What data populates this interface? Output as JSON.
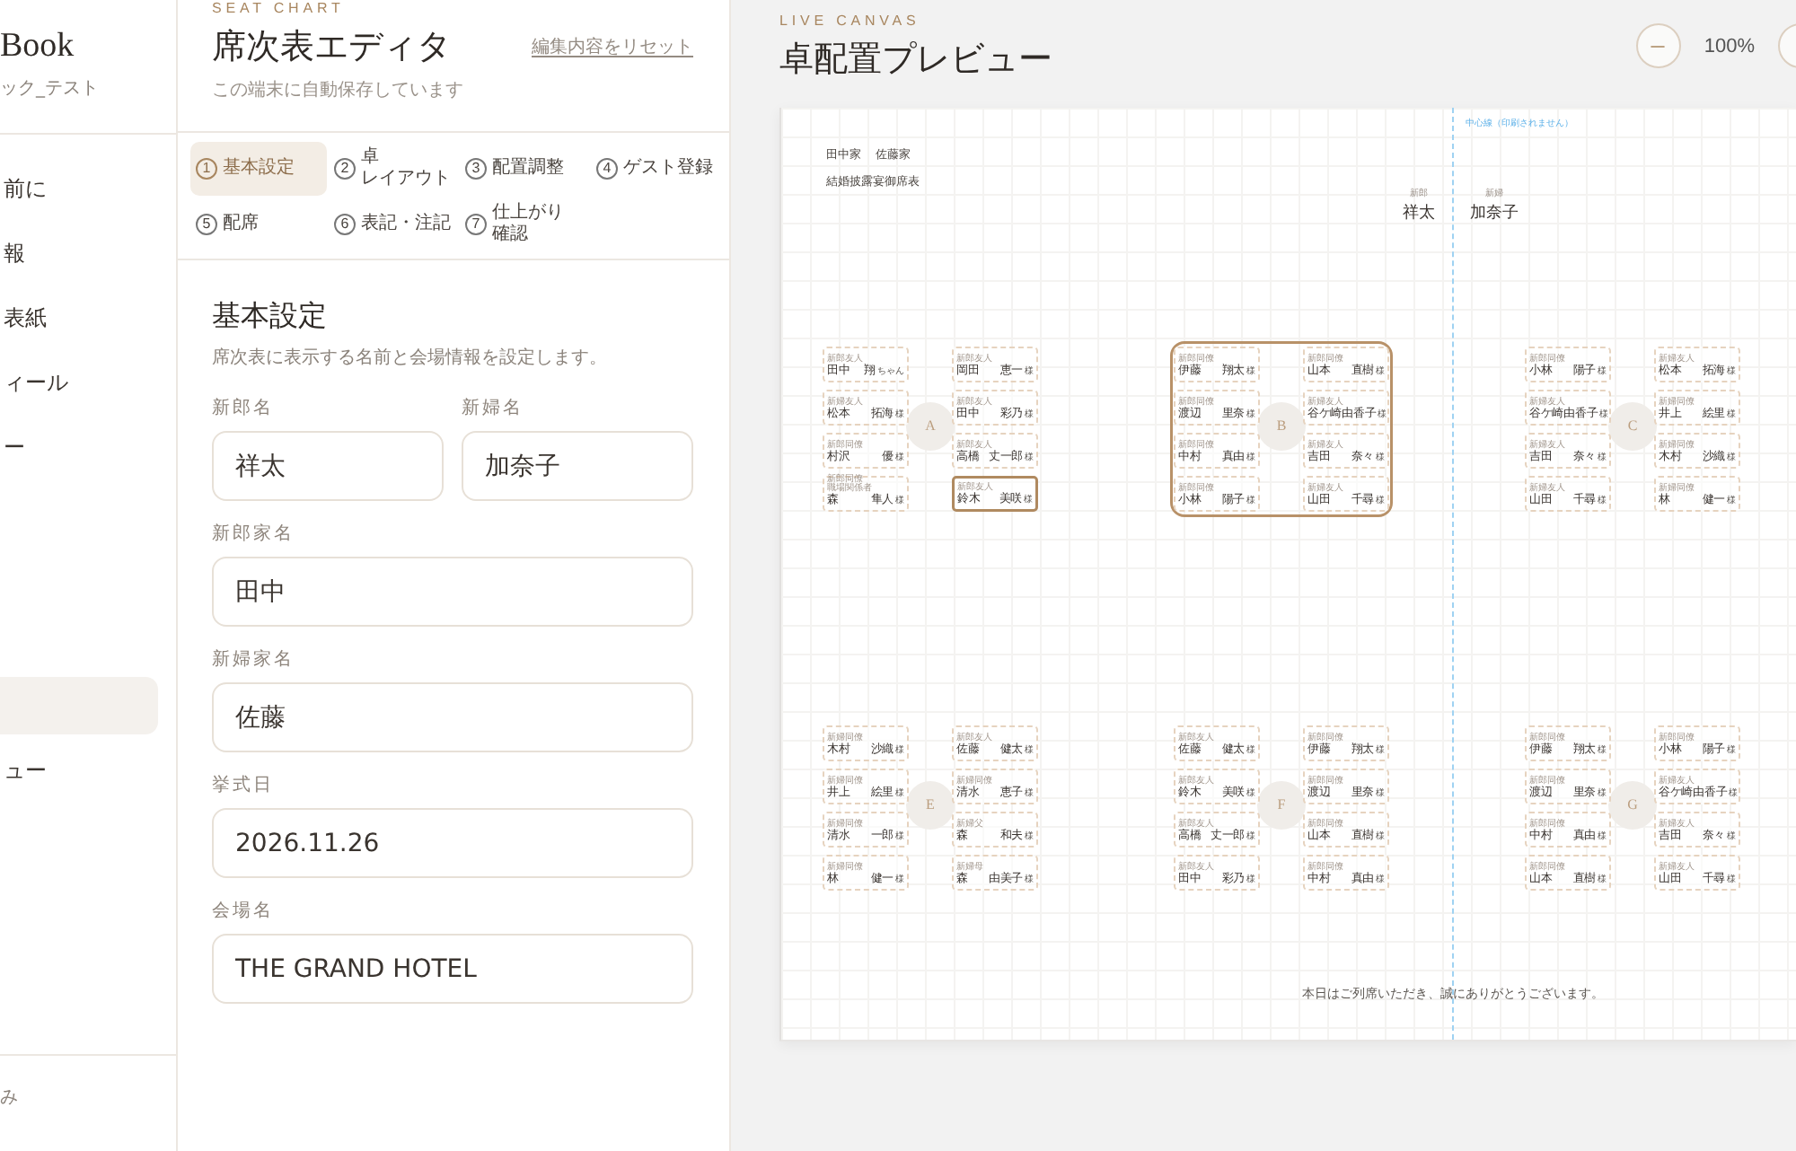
{
  "sidebar": {
    "brand": "Book",
    "subtitle": "ック_テスト",
    "nav_groups": [
      {
        "items": [
          {
            "label": "前に",
            "selected": false
          },
          {
            "label": "報",
            "selected": false
          },
          {
            "label": "表紙",
            "selected": false
          },
          {
            "label": "ィール",
            "selected": false
          },
          {
            "label": "ー",
            "selected": false
          }
        ]
      },
      {
        "items": [
          {
            "selected": true
          },
          {
            "label": "ュー",
            "selected": false
          }
        ]
      }
    ],
    "footer": "み"
  },
  "editor": {
    "eyebrow": "SEAT CHART",
    "title": "席次表エディタ",
    "subtitle": "この端末に自動保存しています",
    "reset_link": "編集内容をリセット",
    "steps": [
      {
        "number": "1",
        "label": "基本設定",
        "selected": true
      },
      {
        "number": "2",
        "label": "卓レイアウト",
        "selected": false
      },
      {
        "number": "3",
        "label": "配置調整",
        "selected": false
      },
      {
        "number": "4",
        "label": "ゲスト登録",
        "selected": false
      },
      {
        "number": "5",
        "label": "配席",
        "selected": false
      },
      {
        "number": "6",
        "label": "表記・注記",
        "selected": false
      },
      {
        "number": "7",
        "label": "仕上がり確認",
        "selected": false
      }
    ],
    "form": {
      "title": "基本設定",
      "description": "席次表に表示する名前と会場情報を設定します。",
      "rows": [
        {
          "fields": [
            {
              "label": "新郎名",
              "value": "祥太"
            },
            {
              "label": "新婦名",
              "value": "加奈子"
            }
          ]
        },
        {
          "fields": [
            {
              "label": "新郎家名",
              "value": "田中"
            }
          ]
        },
        {
          "fields": [
            {
              "label": "新婦家名",
              "value": "佐藤"
            }
          ]
        },
        {
          "fields": [
            {
              "label": "挙式日",
              "value": "2026.11.26"
            }
          ]
        },
        {
          "fields": [
            {
              "label": "会場名",
              "value": "THE GRAND HOTEL"
            }
          ]
        }
      ]
    }
  },
  "preview": {
    "eyebrow": "LIVE CANVAS",
    "title": "卓配置プレビュー",
    "zoom_level": "100%",
    "paper": {
      "center_note": "中心線（印刷されません）",
      "families": [
        "田中家",
        "佐藤家"
      ],
      "heading": "結婚披露宴御席表",
      "couple": [
        {
          "role": "新郎",
          "name": "祥太"
        },
        {
          "role": "新婦",
          "name": "加奈子"
        }
      ],
      "table_rows": [
        {
          "tables": [
            {
              "letter": "A",
              "selected": false,
              "left_seats": [
                {
                  "roles": [
                    "新郎友人"
                  ],
                  "surname": "田中",
                  "given": "翔",
                  "honorific": "ちゃん",
                  "selected": false
                },
                {
                  "roles": [
                    "新婦友人"
                  ],
                  "surname": "松本",
                  "given": "拓海",
                  "honorific": "様",
                  "selected": false
                },
                {
                  "roles": [
                    "新郎同僚"
                  ],
                  "surname": "村沢",
                  "given": "優",
                  "honorific": "様",
                  "selected": false
                },
                {
                  "roles": [
                    "新郎同僚",
                    "職場関係者"
                  ],
                  "surname": "森",
                  "given": "隼人",
                  "honorific": "様",
                  "selected": false
                }
              ],
              "right_seats": [
                {
                  "roles": [
                    "新郎友人"
                  ],
                  "surname": "岡田",
                  "given": "恵一",
                  "honorific": "様",
                  "selected": false
                },
                {
                  "roles": [
                    "新郎友人"
                  ],
                  "surname": "田中",
                  "given": "彩乃",
                  "honorific": "様",
                  "selected": false
                },
                {
                  "roles": [
                    "新郎友人"
                  ],
                  "surname": "高橋",
                  "given": "丈一郎",
                  "honorific": "様",
                  "selected": false
                },
                {
                  "roles": [
                    "新郎友人"
                  ],
                  "surname": "鈴木",
                  "given": "美咲",
                  "honorific": "様",
                  "selected": true
                }
              ]
            },
            {
              "letter": "B",
              "selected": true,
              "left_seats": [
                {
                  "roles": [
                    "新郎同僚"
                  ],
                  "surname": "伊藤",
                  "given": "翔太",
                  "honorific": "様",
                  "selected": false
                },
                {
                  "roles": [
                    "新郎同僚"
                  ],
                  "surname": "渡辺",
                  "given": "里奈",
                  "honorific": "様",
                  "selected": false
                },
                {
                  "roles": [
                    "新郎同僚"
                  ],
                  "surname": "中村",
                  "given": "真由",
                  "honorific": "様",
                  "selected": false
                },
                {
                  "roles": [
                    "新郎同僚"
                  ],
                  "surname": "小林",
                  "given": "陽子",
                  "honorific": "様",
                  "selected": false
                }
              ],
              "right_seats": [
                {
                  "roles": [
                    "新郎同僚"
                  ],
                  "surname": "山本",
                  "given": "直樹",
                  "honorific": "様",
                  "selected": false
                },
                {
                  "roles": [
                    "新婦友人"
                  ],
                  "surname": "谷ケ崎",
                  "given": "由香子",
                  "honorific": "様",
                  "selected": false
                },
                {
                  "roles": [
                    "新婦友人"
                  ],
                  "surname": "吉田",
                  "given": "奈々",
                  "honorific": "様",
                  "selected": false
                },
                {
                  "roles": [
                    "新婦友人"
                  ],
                  "surname": "山田",
                  "given": "千尋",
                  "honorific": "様",
                  "selected": false
                }
              ]
            },
            {
              "letter": "C",
              "selected": false,
              "left_seats": [
                {
                  "roles": [
                    "新郎同僚"
                  ],
                  "surname": "小林",
                  "given": "陽子",
                  "honorific": "様",
                  "selected": false
                },
                {
                  "roles": [
                    "新婦友人"
                  ],
                  "surname": "谷ケ崎",
                  "given": "由香子",
                  "honorific": "様",
                  "selected": false
                },
                {
                  "roles": [
                    "新婦友人"
                  ],
                  "surname": "吉田",
                  "given": "奈々",
                  "honorific": "様",
                  "selected": false
                },
                {
                  "roles": [
                    "新婦友人"
                  ],
                  "surname": "山田",
                  "given": "千尋",
                  "honorific": "様",
                  "selected": false
                }
              ],
              "right_seats": [
                {
                  "roles": [
                    "新婦友人"
                  ],
                  "surname": "松本",
                  "given": "拓海",
                  "honorific": "様",
                  "selected": false
                },
                {
                  "roles": [
                    "新婦同僚"
                  ],
                  "surname": "井上",
                  "given": "絵里",
                  "honorific": "様",
                  "selected": false
                },
                {
                  "roles": [
                    "新婦同僚"
                  ],
                  "surname": "木村",
                  "given": "沙織",
                  "honorific": "様",
                  "selected": false
                },
                {
                  "roles": [
                    "新婦同僚"
                  ],
                  "surname": "林",
                  "given": "健一",
                  "honorific": "様",
                  "selected": false
                }
              ]
            }
          ]
        },
        {
          "tables": [
            {
              "letter": "E",
              "selected": false,
              "left_seats": [
                {
                  "roles": [
                    "新婦同僚"
                  ],
                  "surname": "木村",
                  "given": "沙織",
                  "honorific": "様",
                  "selected": false
                },
                {
                  "roles": [
                    "新婦同僚"
                  ],
                  "surname": "井上",
                  "given": "絵里",
                  "honorific": "様",
                  "selected": false
                },
                {
                  "roles": [
                    "新婦同僚"
                  ],
                  "surname": "清水",
                  "given": "一郎",
                  "honorific": "様",
                  "selected": false
                },
                {
                  "roles": [
                    "新婦同僚"
                  ],
                  "surname": "林",
                  "given": "健一",
                  "honorific": "様",
                  "selected": false
                }
              ],
              "right_seats": [
                {
                  "roles": [
                    "新郎友人"
                  ],
                  "surname": "佐藤",
                  "given": "健太",
                  "honorific": "様",
                  "selected": false
                },
                {
                  "roles": [
                    "新婦同僚"
                  ],
                  "surname": "清水",
                  "given": "恵子",
                  "honorific": "様",
                  "selected": false
                },
                {
                  "roles": [
                    "新婦父"
                  ],
                  "surname": "森",
                  "given": "和夫",
                  "honorific": "様",
                  "selected": false
                },
                {
                  "roles": [
                    "新婦母"
                  ],
                  "surname": "森",
                  "given": "由美子",
                  "honorific": "様",
                  "selected": false
                }
              ]
            },
            {
              "letter": "F",
              "selected": false,
              "left_seats": [
                {
                  "roles": [
                    "新郎友人"
                  ],
                  "surname": "佐藤",
                  "given": "健太",
                  "honorific": "様",
                  "selected": false
                },
                {
                  "roles": [
                    "新郎友人"
                  ],
                  "surname": "鈴木",
                  "given": "美咲",
                  "honorific": "様",
                  "selected": false
                },
                {
                  "roles": [
                    "新郎友人"
                  ],
                  "surname": "高橋",
                  "given": "丈一郎",
                  "honorific": "様",
                  "selected": false
                },
                {
                  "roles": [
                    "新郎友人"
                  ],
                  "surname": "田中",
                  "given": "彩乃",
                  "honorific": "様",
                  "selected": false
                }
              ],
              "right_seats": [
                {
                  "roles": [
                    "新郎同僚"
                  ],
                  "surname": "伊藤",
                  "given": "翔太",
                  "honorific": "様",
                  "selected": false
                },
                {
                  "roles": [
                    "新郎同僚"
                  ],
                  "surname": "渡辺",
                  "given": "里奈",
                  "honorific": "様",
                  "selected": false
                },
                {
                  "roles": [
                    "新郎同僚"
                  ],
                  "surname": "山本",
                  "given": "直樹",
                  "honorific": "様",
                  "selected": false
                },
                {
                  "roles": [
                    "新郎同僚"
                  ],
                  "surname": "中村",
                  "given": "真由",
                  "honorific": "様",
                  "selected": false
                }
              ]
            },
            {
              "letter": "G",
              "selected": false,
              "left_seats": [
                {
                  "roles": [
                    "新郎同僚"
                  ],
                  "surname": "伊藤",
                  "given": "翔太",
                  "honorific": "様",
                  "selected": false
                },
                {
                  "roles": [
                    "新郎同僚"
                  ],
                  "surname": "渡辺",
                  "given": "里奈",
                  "honorific": "様",
                  "selected": false
                },
                {
                  "roles": [
                    "新郎同僚"
                  ],
                  "surname": "中村",
                  "given": "真由",
                  "honorific": "様",
                  "selected": false
                },
                {
                  "roles": [
                    "新郎同僚"
                  ],
                  "surname": "山本",
                  "given": "直樹",
                  "honorific": "様",
                  "selected": false
                }
              ],
              "right_seats": [
                {
                  "roles": [
                    "新郎同僚"
                  ],
                  "surname": "小林",
                  "given": "陽子",
                  "honorific": "様",
                  "selected": false
                },
                {
                  "roles": [
                    "新婦友人"
                  ],
                  "surname": "谷ケ崎",
                  "given": "由香子",
                  "honorific": "様",
                  "selected": false
                },
                {
                  "roles": [
                    "新婦友人"
                  ],
                  "surname": "吉田",
                  "given": "奈々",
                  "honorific": "様",
                  "selected": false
                },
                {
                  "roles": [
                    "新婦友人"
                  ],
                  "surname": "山田",
                  "given": "千尋",
                  "honorific": "様",
                  "selected": false
                }
              ]
            }
          ]
        }
      ],
      "closing": "本日はご列席いただき、誠にありがとうございます。"
    }
  }
}
